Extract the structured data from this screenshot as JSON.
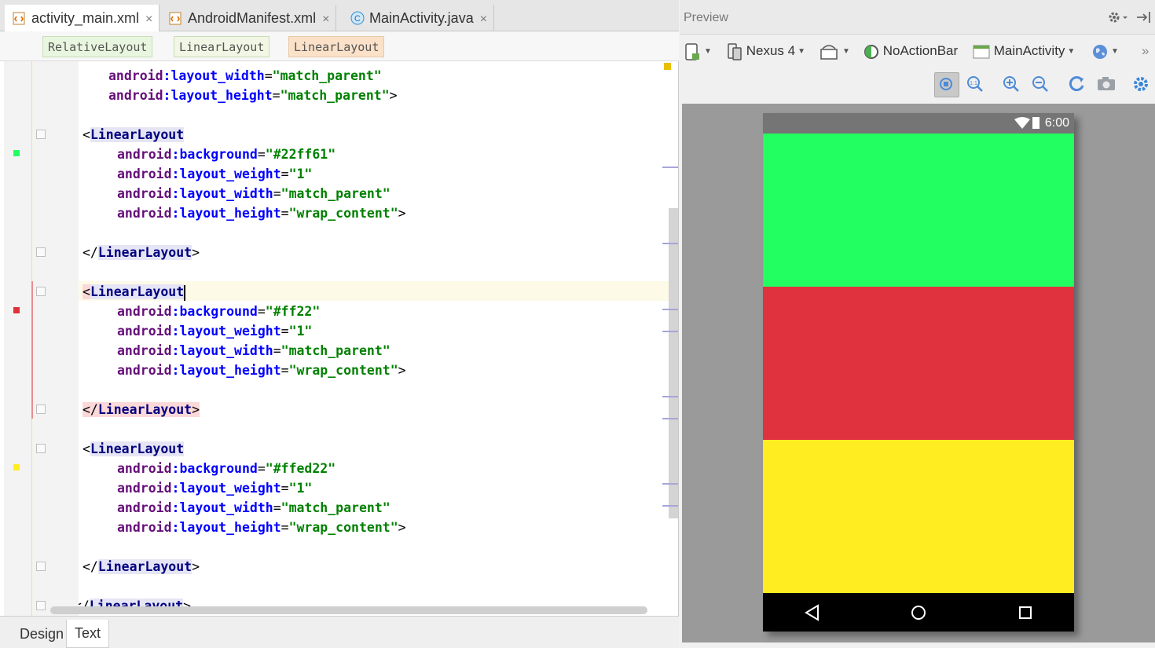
{
  "editor": {
    "tabs": [
      {
        "label": "activity_main.xml",
        "close": "×",
        "icon": "xml-file-icon"
      },
      {
        "label": "AndroidManifest.xml",
        "close": "×",
        "icon": "xml-file-icon"
      },
      {
        "label": "MainActivity.java",
        "close": "×",
        "icon": "java-class-icon"
      }
    ],
    "breadcrumbs": [
      "RelativeLayout",
      "LinearLayout",
      "LinearLayout"
    ],
    "code": {
      "l1_attr": "layout_width",
      "l1_val": "\"match_parent\"",
      "l2_attr": "layout_height",
      "l2_val": "\"match_parent\"",
      "ns": "android",
      "tag": "LinearLayout",
      "a_background": "background",
      "a_weight": "layout_weight",
      "a_width": "layout_width",
      "a_height": "layout_height",
      "v_weight": "\"1\"",
      "v_match": "\"match_parent\"",
      "v_wrap": "\"wrap_content\"",
      "bg1": "\"#22ff61\"",
      "bg2": "\"#ff22\"",
      "bg3": "\"#ffed22\""
    },
    "bottom_tabs": [
      "Design",
      "Text"
    ],
    "gutter_colors": [
      "#22ff61",
      "#e03038",
      "#ffed22"
    ]
  },
  "preview": {
    "title": "Preview",
    "toolbar": {
      "device": "Nexus 4",
      "theme": "NoActionBar",
      "activity": "MainActivity"
    },
    "device_screen": {
      "time": "6:00",
      "bands": [
        "#22ff61",
        "#e0313f",
        "#ffed22"
      ]
    }
  }
}
